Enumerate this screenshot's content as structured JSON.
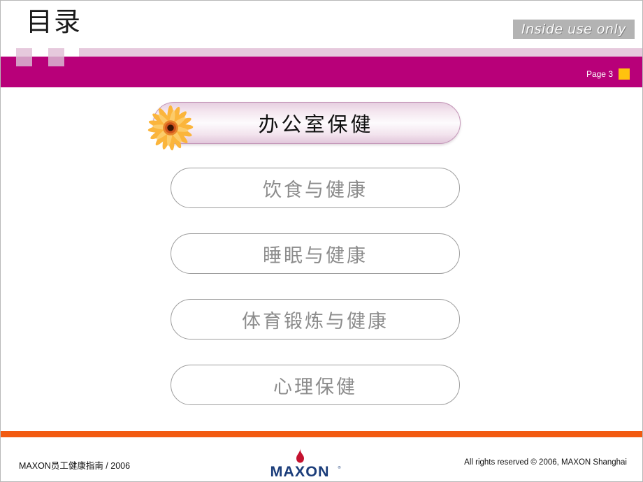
{
  "header": {
    "title": "目录",
    "badge": "Inside use only",
    "page_label": "Page 3",
    "marker_icon": "yellow-square-marker",
    "colors": {
      "magenta": "#b80079",
      "pale_pink": "#e6c9dd",
      "mid_pink": "#d49cc4",
      "badge_gray": "#b3b3b3",
      "marker_yellow": "#ffc20e"
    }
  },
  "toc": {
    "items": [
      {
        "label": "办公室保健",
        "highlighted": true,
        "icon": "gerbera-flower-icon"
      },
      {
        "label": "饮食与健康",
        "highlighted": false,
        "icon": ""
      },
      {
        "label": "睡眠与健康",
        "highlighted": false,
        "icon": ""
      },
      {
        "label": "体育锻炼与健康",
        "highlighted": false,
        "icon": ""
      },
      {
        "label": "心理保健",
        "highlighted": false,
        "icon": ""
      }
    ],
    "colors": {
      "pill_border": "#9d9d9d",
      "pill_text": "#8c8c8c",
      "highlight_border": "#c497b8",
      "highlight_text": "#111111"
    }
  },
  "footer": {
    "left_text": "MAXON员工健康指南   / 2006",
    "right_text": "All rights reserved © 2006, MAXON Shanghai",
    "logo_text": "MAXON",
    "logo_icon": "maxon-flame-logo",
    "bar_color": "#f25a10",
    "logo_blue": "#1b3d7a",
    "logo_red": "#c4122f"
  }
}
